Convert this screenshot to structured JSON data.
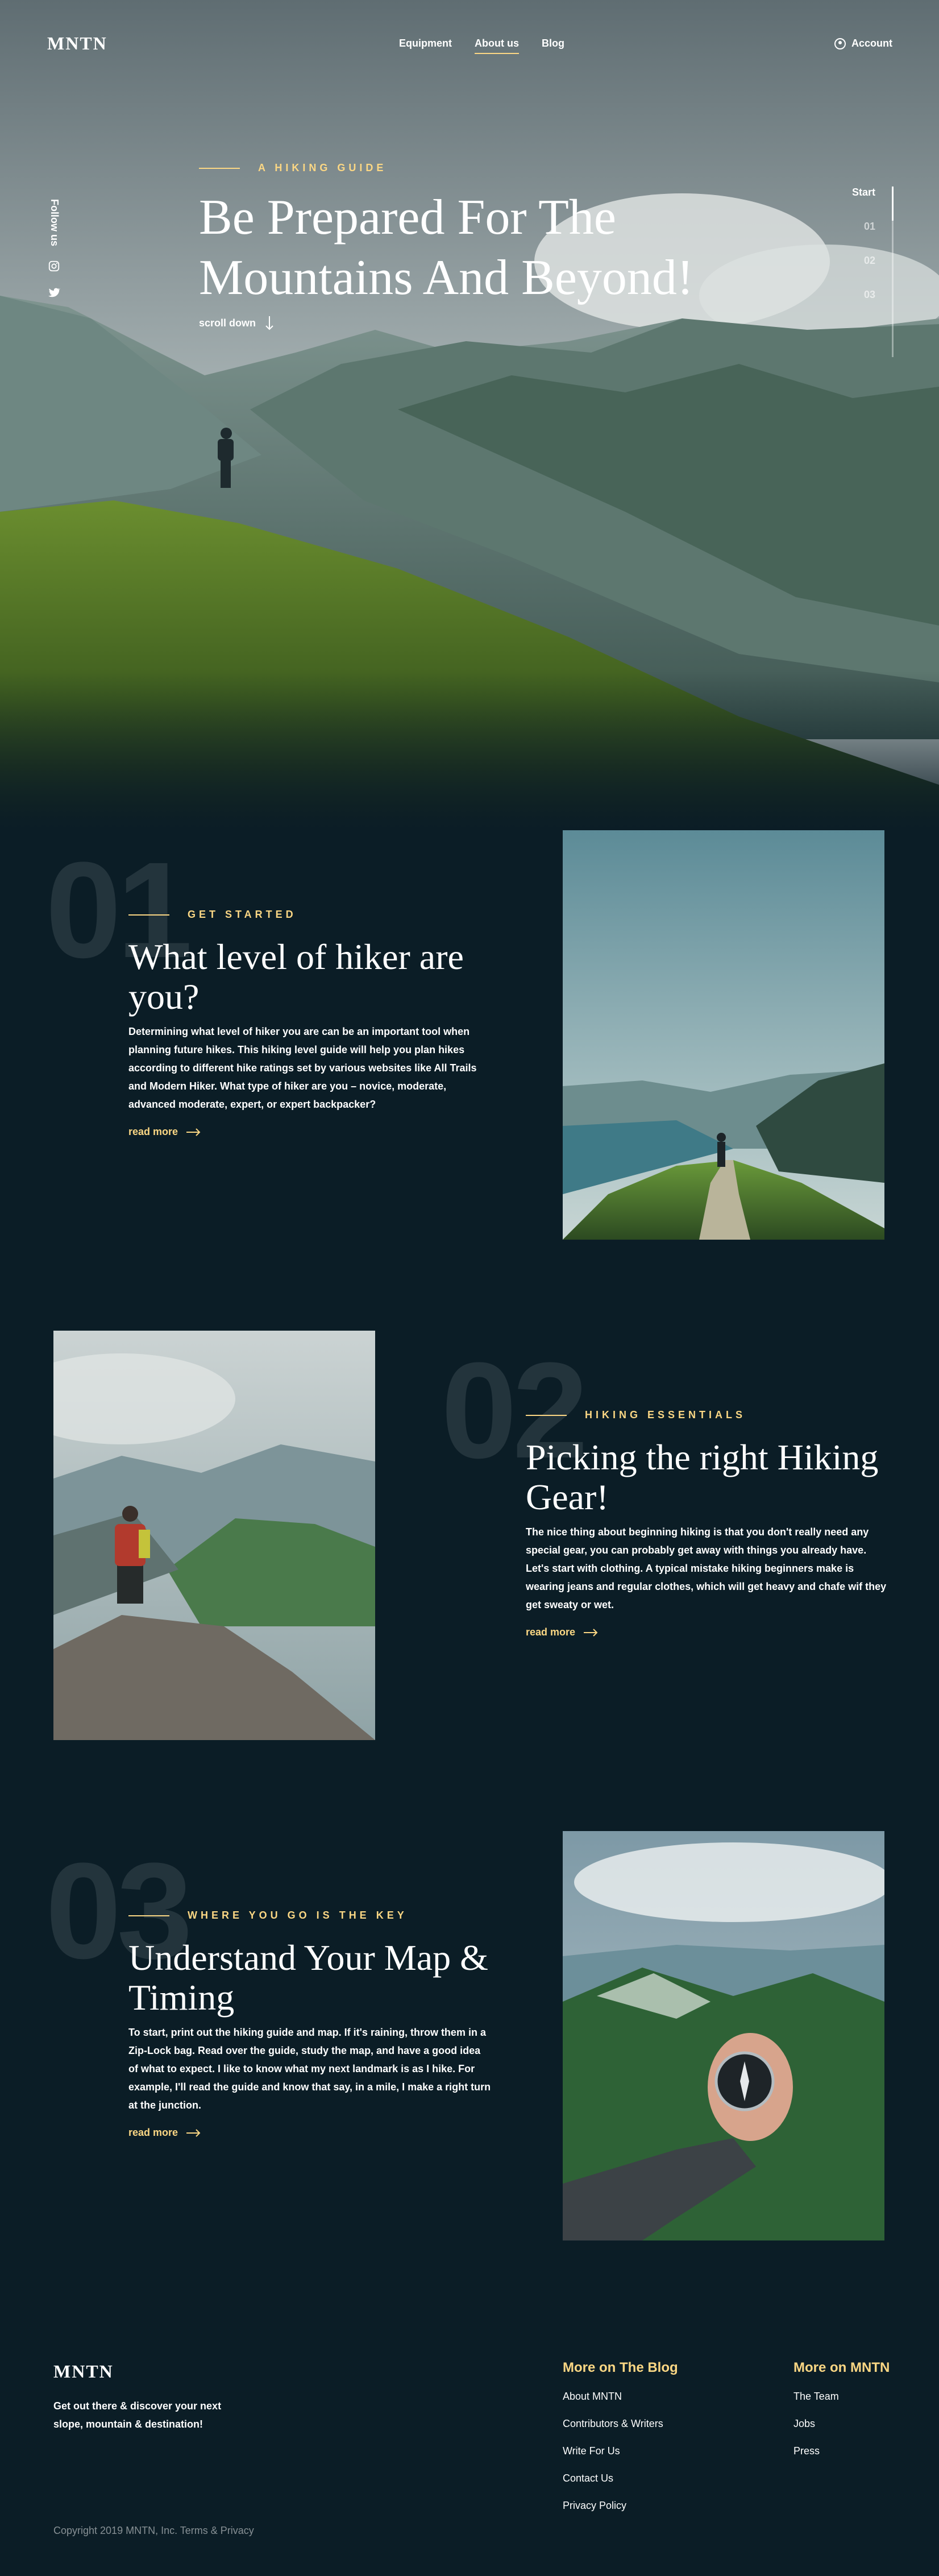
{
  "nav": {
    "logo": "MNTN",
    "links": [
      "Equipment",
      "About us",
      "Blog"
    ],
    "active": "About us",
    "account": "Account"
  },
  "hero": {
    "follow": "Follow us",
    "eyebrow": "A HIKING GUIDE",
    "title": "Be Prepared For The Mountains And Beyond!",
    "scroll": "scroll down",
    "slider": [
      "Start",
      "01",
      "02",
      "03"
    ]
  },
  "sections": [
    {
      "number": "01",
      "eyebrow": "GET STARTED",
      "title": "What level of hiker are you?",
      "body": "Determining what level of hiker you are can be an important tool when planning future hikes. This hiking level guide will help you plan hikes according to different hike ratings set by various websites like All Trails and Modern Hiker. What type of hiker are you – novice, moderate, advanced moderate, expert, or expert backpacker?",
      "link": "read more"
    },
    {
      "number": "02",
      "eyebrow": "HIKING ESSENTIALS",
      "title": "Picking the right Hiking Gear!",
      "body": "The nice thing about beginning hiking is that you don't really need any special gear, you can probably get away with things you already have. Let's start with clothing. A typical mistake hiking beginners make is wearing jeans and regular clothes, which will get heavy and chafe wif they get sweaty or wet.",
      "link": "read more"
    },
    {
      "number": "03",
      "eyebrow": "WHERE YOU GO IS THE KEY",
      "title": "Understand Your Map & Timing",
      "body": "To start, print out the hiking guide and map. If it's raining, throw them in a Zip-Lock bag. Read over the guide, study the map, and have a good idea of what to expect. I like to know what my next landmark is as I hike. For example, I'll read the guide and know that say, in a mile, I make a right turn at the junction.",
      "link": "read more"
    }
  ],
  "footer": {
    "logo": "MNTN",
    "tagline": "Get out there & discover your next slope, mountain & destination!",
    "copyright": "Copyright 2019 MNTN, Inc. Terms & Privacy",
    "blog_heading": "More on The Blog",
    "blog_links": [
      "About MNTN",
      "Contributors & Writers",
      "Write For Us",
      "Contact Us",
      "Privacy Policy"
    ],
    "mntn_heading": "More on MNTN",
    "mntn_links": [
      "The Team",
      "Jobs",
      "Press"
    ]
  },
  "colors": {
    "background": "#0b1d26",
    "accent": "#fbd784",
    "text": "#ffffff"
  },
  "icons": [
    "instagram-icon",
    "twitter-icon",
    "account-icon",
    "arrow-down-icon",
    "arrow-right-icon"
  ]
}
